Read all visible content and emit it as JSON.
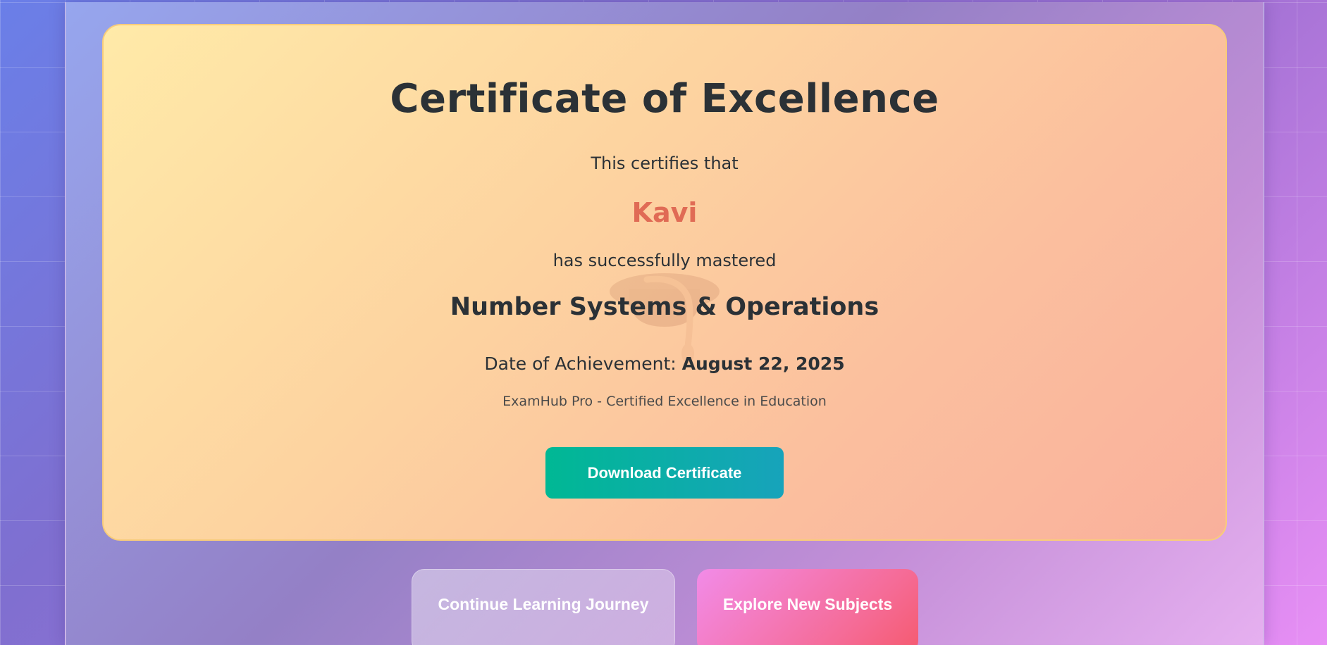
{
  "certificate": {
    "title": "Certificate of Excellence",
    "certifies_text": "This certifies that",
    "recipient_name": "Kavi",
    "mastered_text": "has successfully mastered",
    "subject": "Number Systems & Operations",
    "date_label": "Date of Achievement:",
    "date_value": "August 22, 2025",
    "issuer": "ExamHub Pro - Certified Excellence in Education",
    "download_label": "Download Certificate",
    "watermark_icon": "graduation-cap-icon"
  },
  "actions": {
    "continue_label": "Continue Learning Journey",
    "explore_label": "Explore New Subjects"
  },
  "colors": {
    "recipient": "#e06b55",
    "download_start": "#00b894",
    "download_end": "#17a3bb",
    "explore_start": "#f28be8",
    "explore_end": "#f55a6f",
    "certificate_border": "#f8cc7a"
  }
}
